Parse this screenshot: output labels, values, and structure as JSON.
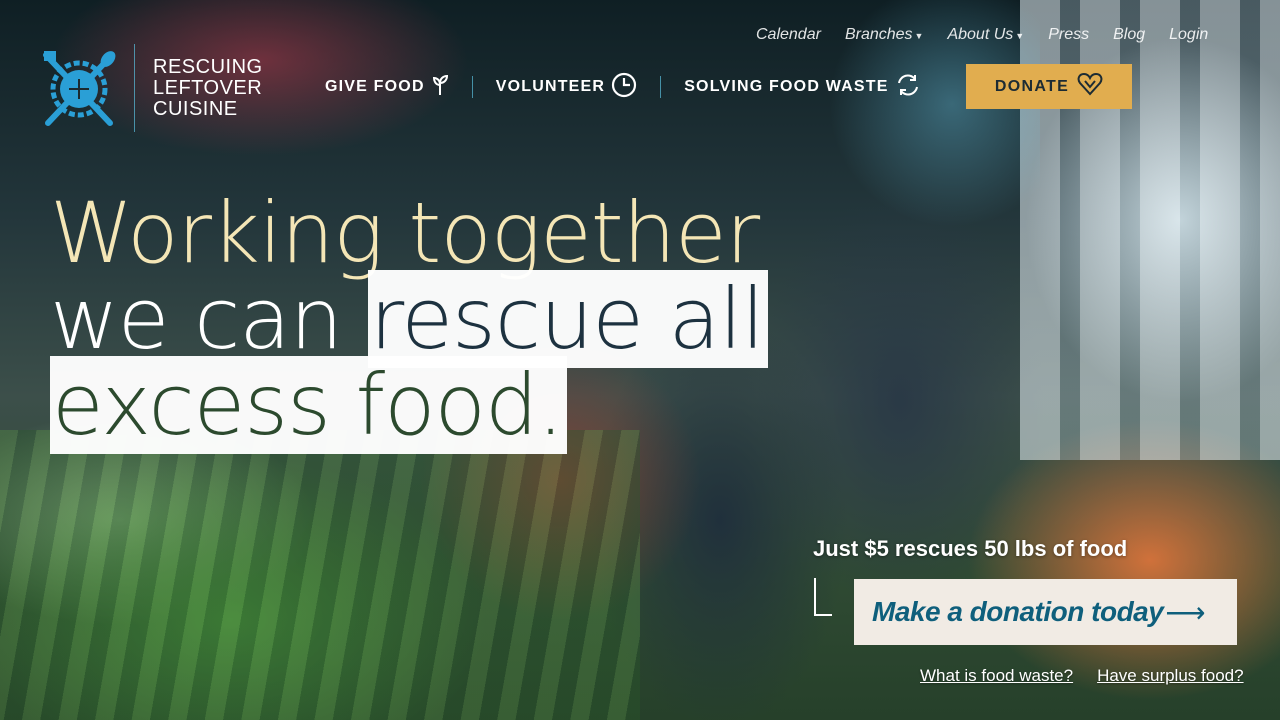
{
  "brand": {
    "name_lines": [
      "Rescuing",
      "Leftover",
      "Cuisine"
    ],
    "accent_color": "#2a9fd6"
  },
  "utility_nav": [
    {
      "label": "Calendar",
      "dropdown": false
    },
    {
      "label": "Branches",
      "dropdown": true
    },
    {
      "label": "About Us",
      "dropdown": true
    },
    {
      "label": "Press",
      "dropdown": false
    },
    {
      "label": "Blog",
      "dropdown": false
    },
    {
      "label": "Login",
      "dropdown": false
    }
  ],
  "main_nav": [
    {
      "label": "Give Food",
      "icon": "sprout-icon"
    },
    {
      "label": "Volunteer",
      "icon": "clock-icon"
    },
    {
      "label": "Solving Food Waste",
      "icon": "recycle-icon"
    }
  ],
  "donate": {
    "label": "Donate",
    "icon": "heart-icon",
    "color": "#e1ad4f"
  },
  "hero": {
    "line1": "Working together",
    "line2_plain": "we can ",
    "line2_highlight": "rescue all",
    "line3_highlight": "excess food."
  },
  "cta": {
    "tagline": "Just $5 rescues 50 lbs of food",
    "button_label": "Make a donation today",
    "arrow": "⟶"
  },
  "sub_links": [
    "What is food waste?",
    "Have surplus food?"
  ]
}
